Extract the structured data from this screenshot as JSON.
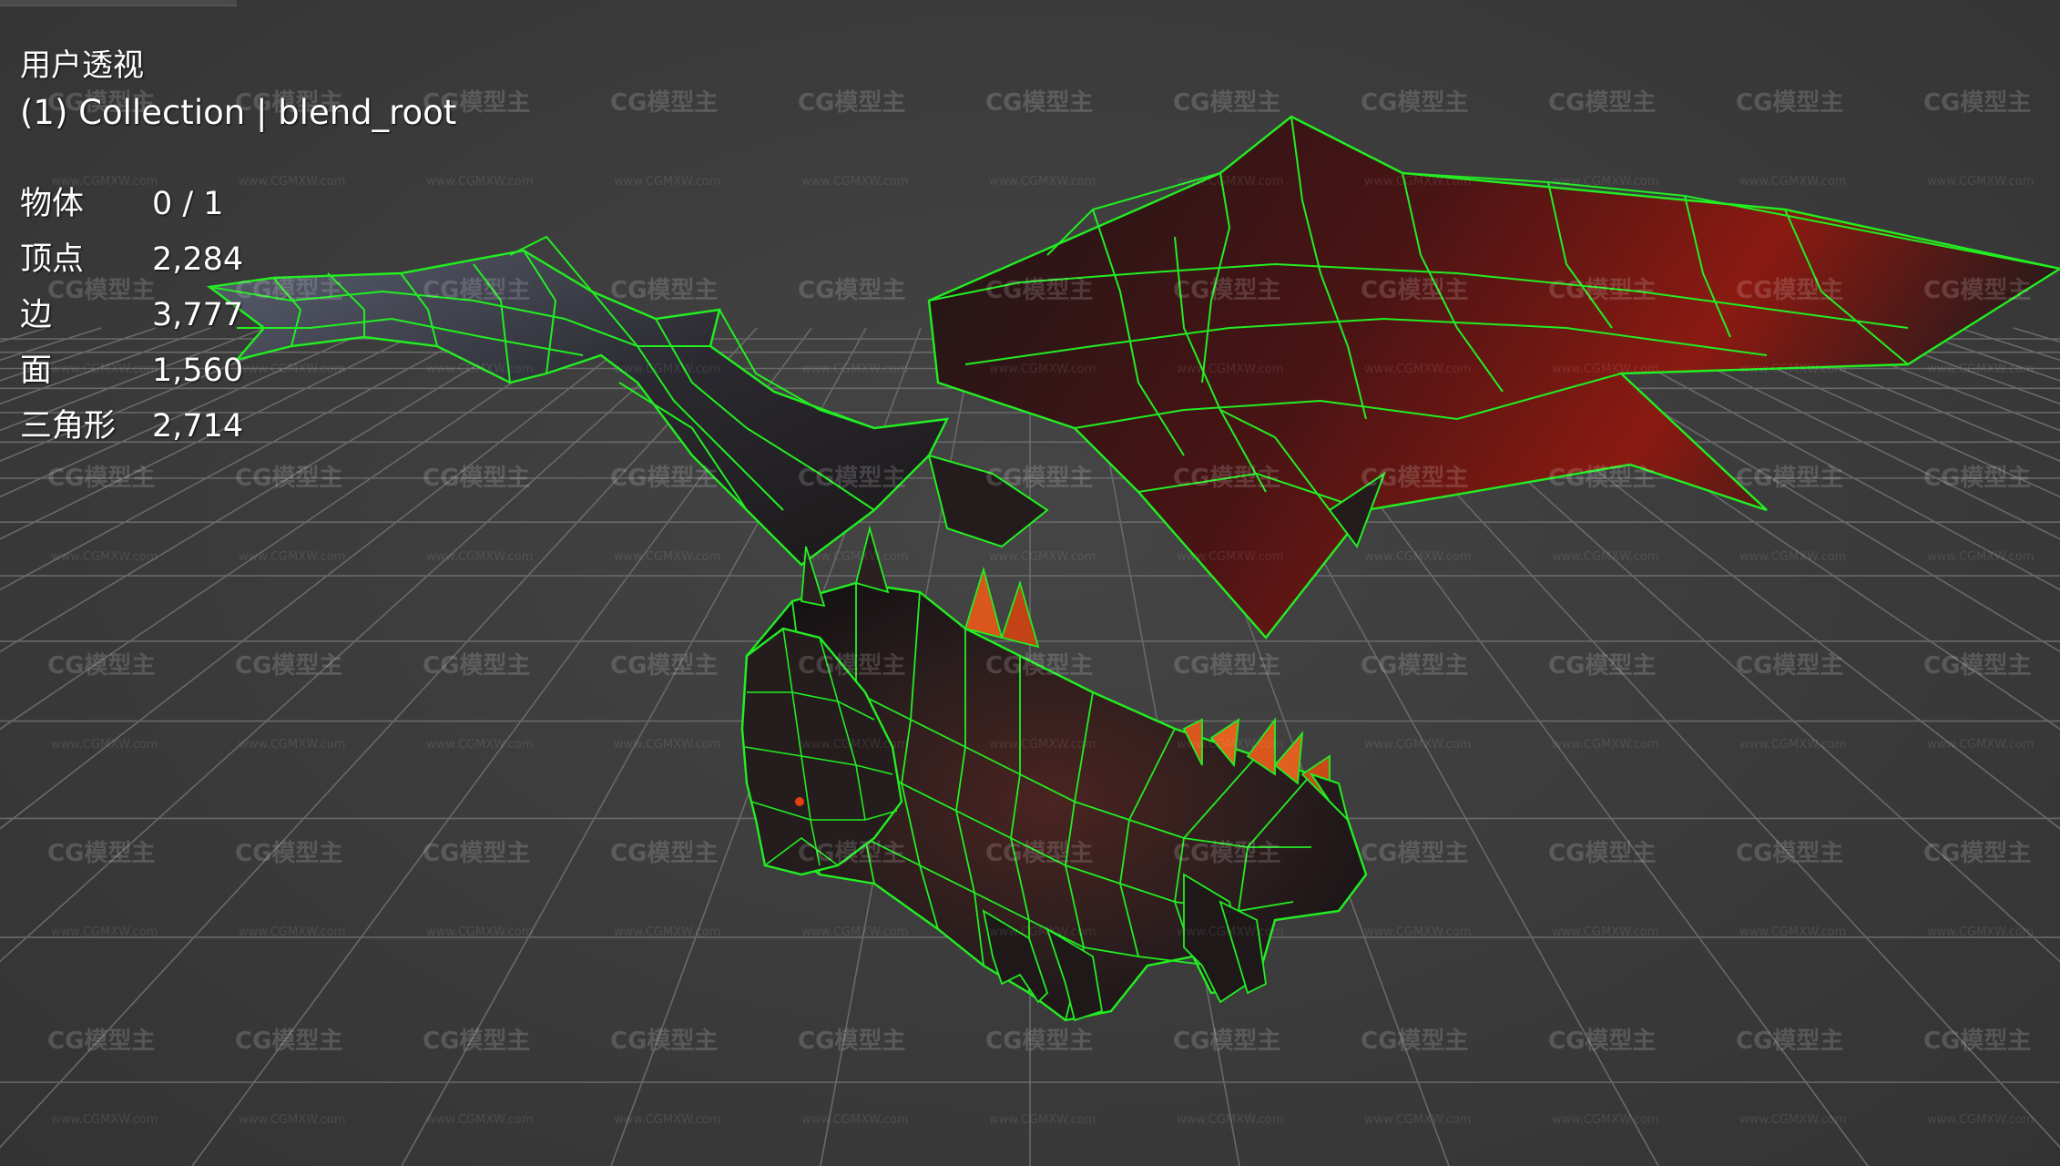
{
  "viewport": {
    "view_name": "用户透视",
    "collection_line": "(1) Collection | blend_root"
  },
  "stats": [
    {
      "label": "物体",
      "value": "0 / 1"
    },
    {
      "label": "顶点",
      "value": "2,284"
    },
    {
      "label": "边",
      "value": "3,777"
    },
    {
      "label": "面",
      "value": "1,560"
    },
    {
      "label": "三角形",
      "value": "2,714"
    }
  ],
  "watermark": {
    "logo_text": "CG模型主",
    "url_text": "www.CGMXW.com"
  },
  "colors": {
    "background": "#3d3d3d",
    "grid_line": "#6a6a6a",
    "wireframe": "#22ee22",
    "dragon_body": "#2a2022",
    "dragon_red": "#7a1010",
    "spike": "#e0501a"
  },
  "model": {
    "icon": "wireframe-dragon-model"
  }
}
